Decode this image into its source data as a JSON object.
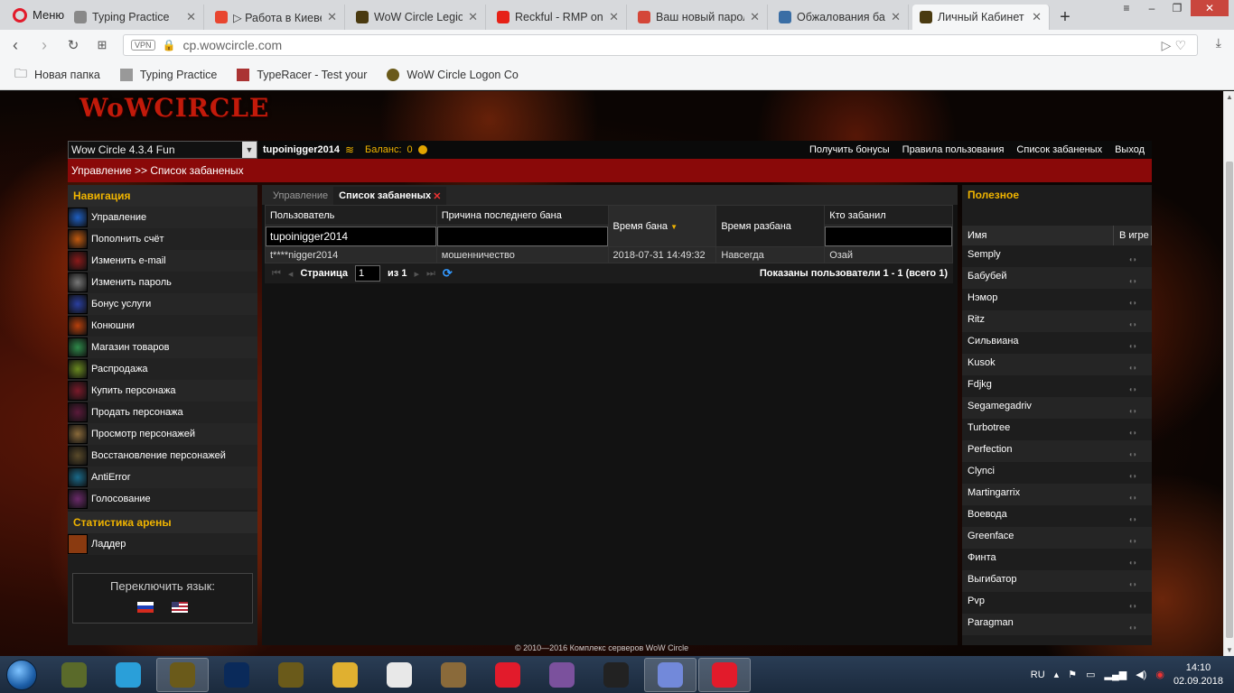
{
  "browser": {
    "menu_label": "Меню",
    "tabs": [
      {
        "title": "Typing Practice",
        "color": "#888888"
      },
      {
        "title": "▷ Работа в Киеве",
        "color": "#e8452f"
      },
      {
        "title": "WoW Circle Legion",
        "color": "#4a3a10"
      },
      {
        "title": "Reckful - RMP on r",
        "color": "#e62117"
      },
      {
        "title": "Ваш новый пароль",
        "color": "#d44638"
      },
      {
        "title": "Обжалования бан",
        "color": "#3a6ea5"
      },
      {
        "title": "Личный Кабинет",
        "color": "#4a3a10",
        "active": true
      }
    ],
    "vpn_label": "VPN",
    "url": "cp.wowcircle.com",
    "bookmarks": [
      "Новая папка",
      "Typing Practice",
      "TypeRacer - Test your",
      "WoW Circle Logon Co"
    ]
  },
  "site": {
    "logo": "WoWCIRCLE",
    "realm": "Wow Circle 4.3.4 Fun",
    "username": "tupoinigger2014",
    "balance_label": "Баланс:",
    "balance_value": "0",
    "top_links": [
      "Получить бонусы",
      "Правила пользования",
      "Список забаненых",
      "Выход"
    ],
    "breadcrumb": "Управление >>  Список забаненых",
    "nav_title": "Навигация",
    "nav_items": [
      {
        "label": "Управление",
        "color": "#1f5fc2"
      },
      {
        "label": "Пополнить счёт",
        "color": "#c25a10"
      },
      {
        "label": "Изменить e-mail",
        "color": "#8a1a1a"
      },
      {
        "label": "Изменить пароль",
        "color": "#777777"
      },
      {
        "label": "Бонус услуги",
        "color": "#2a3fa0"
      },
      {
        "label": "Конюшни",
        "color": "#b8400c"
      },
      {
        "label": "Магазин товаров",
        "color": "#2f8a4a"
      },
      {
        "label": "Распродажа",
        "color": "#6a8a20"
      },
      {
        "label": "Купить персонажа",
        "color": "#7a1a2a"
      },
      {
        "label": "Продать персонажа",
        "color": "#5a1a3a"
      },
      {
        "label": "Просмотр персонажей",
        "color": "#8a6a3a"
      },
      {
        "label": "Восстановление персонажей",
        "color": "#5a4a2a"
      },
      {
        "label": "AntiError",
        "color": "#1a6a8a"
      },
      {
        "label": "Голосование",
        "color": "#6a2a6a"
      }
    ],
    "arena_title": "Статистика арены",
    "arena_items": [
      "Ладдер"
    ],
    "lang_title": "Переключить язык:",
    "copyright": "© 2010—2016 Комплекс серверов WoW Circle"
  },
  "bans": {
    "tabs": [
      "Управление",
      "Список забаненых"
    ],
    "columns": [
      "Пользователь",
      "Причина последнего бана",
      "Время бана",
      "Время разбана",
      "Кто забанил"
    ],
    "filter_user": "tupoinigger2014",
    "rows": [
      [
        "t****nigger2014",
        "мошенничество",
        "2018-07-31 14:49:32",
        "Навсегда",
        "Озай"
      ]
    ],
    "pager": {
      "page_label": "Страница",
      "page": "1",
      "of_label": "из 1",
      "info": "Показаны пользователи 1 - 1 (всего 1)"
    }
  },
  "useful": {
    "title": "Полезное",
    "col_name": "Имя",
    "col_status": "В игре",
    "players": [
      "Semply",
      "Бабубей",
      "Нэмор",
      "Ritz",
      "Сильвиана",
      "Kusok",
      "Fdjkg",
      "Segamegadriv",
      "Turbotree",
      "Perfection",
      "Clynci",
      "Martingarrix",
      "Воевода",
      "Greenface",
      "Финта",
      "Выгибатор",
      "Pvp",
      "Paragman"
    ]
  },
  "taskbar": {
    "lang": "RU",
    "time": "14:10",
    "date": "02.09.2018",
    "apps": [
      {
        "name": "wow-icon",
        "color": "#5a6a2a"
      },
      {
        "name": "telegram-icon",
        "color": "#2a9fd9"
      },
      {
        "name": "wow-circle-icon",
        "color": "#6a5a1a",
        "active": true
      },
      {
        "name": "battlenet-icon",
        "color": "#0a2a5a"
      },
      {
        "name": "wow-legion-icon",
        "color": "#6a5a1a"
      },
      {
        "name": "explorer-icon",
        "color": "#e0b030"
      },
      {
        "name": "itunes-icon",
        "color": "#e8e8e8"
      },
      {
        "name": "metronome-icon",
        "color": "#8a6a3a"
      },
      {
        "name": "opera-icon",
        "color": "#e21b2b"
      },
      {
        "name": "viber-icon",
        "color": "#7b519d"
      },
      {
        "name": "guitar-pro-icon",
        "color": "#222222"
      },
      {
        "name": "discord-icon",
        "color": "#7289da",
        "active": true
      },
      {
        "name": "opera-gx-icon",
        "color": "#e21b2b",
        "active": true
      }
    ]
  }
}
